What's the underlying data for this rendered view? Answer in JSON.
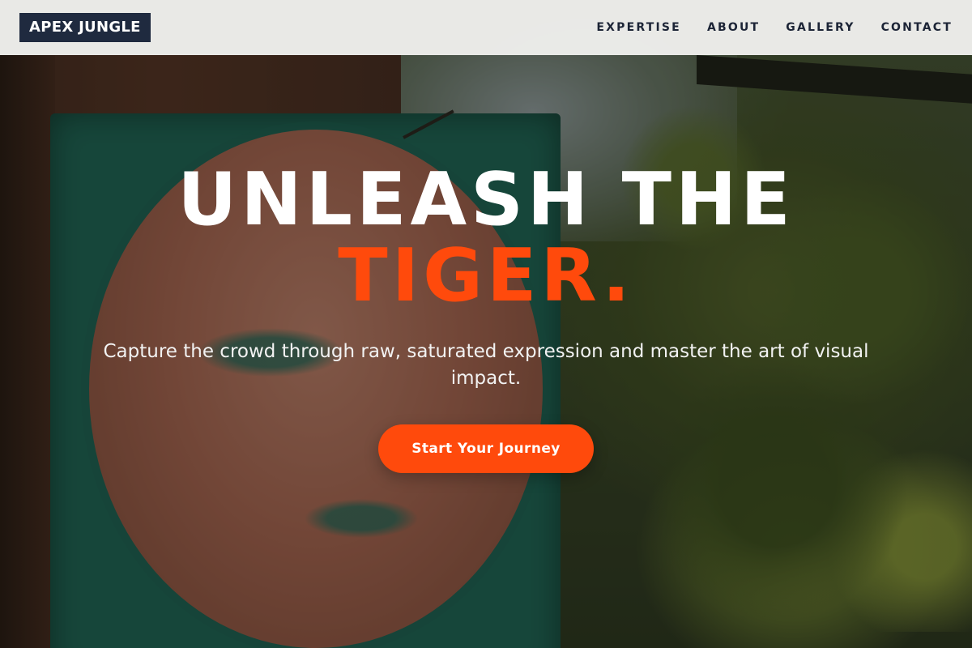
{
  "header": {
    "brand": "APEX JUNGLE",
    "nav": [
      {
        "label": "EXPERTISE"
      },
      {
        "label": "ABOUT"
      },
      {
        "label": "GALLERY"
      },
      {
        "label": "CONTACT"
      }
    ]
  },
  "hero": {
    "headline_line1": "UNLEASH THE",
    "headline_line2": "TIGER.",
    "subheadline": "Capture the crowd through raw, saturated expression and master the art of visual impact.",
    "cta_label": "Start Your Journey"
  },
  "colors": {
    "accent": "#ff4a0c",
    "brand_bg": "#1f2a3f",
    "nav_text": "#1c2436",
    "header_bg": "#f0f0ee"
  }
}
